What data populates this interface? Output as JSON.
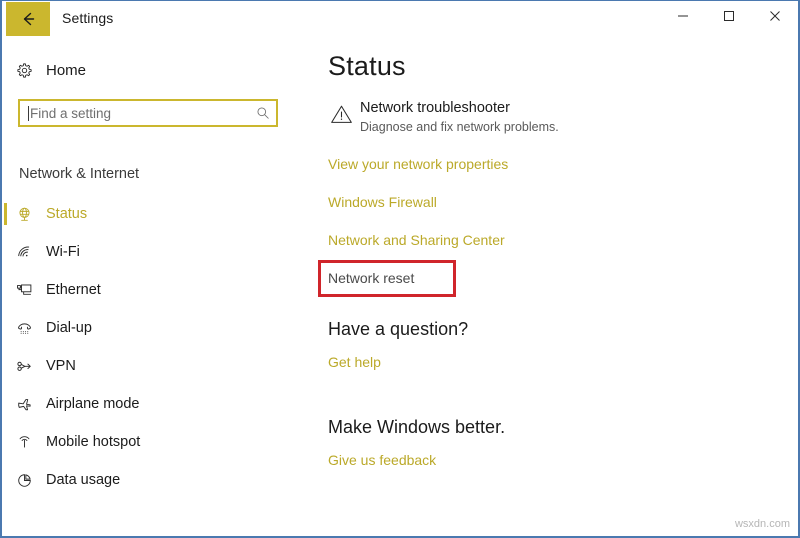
{
  "window": {
    "title": "Settings",
    "back_icon": "back-arrow-icon",
    "minimize_label": "─",
    "maximize_label": "□",
    "close_label": "✕",
    "border_color": "#4b79b0",
    "accent_color": "#cbb72e"
  },
  "sidebar": {
    "home": {
      "label": "Home",
      "icon": "gear-icon"
    },
    "search": {
      "value": "",
      "placeholder": "Find a setting",
      "icon": "search-icon"
    },
    "section_header": "Network & Internet",
    "items": [
      {
        "label": "Status",
        "icon": "globe-network-icon",
        "selected": true
      },
      {
        "label": "Wi-Fi",
        "icon": "wifi-icon",
        "selected": false
      },
      {
        "label": "Ethernet",
        "icon": "ethernet-icon",
        "selected": false
      },
      {
        "label": "Dial-up",
        "icon": "dialup-phone-icon",
        "selected": false
      },
      {
        "label": "VPN",
        "icon": "vpn-icon",
        "selected": false
      },
      {
        "label": "Airplane mode",
        "icon": "airplane-icon",
        "selected": false
      },
      {
        "label": "Mobile hotspot",
        "icon": "hotspot-icon",
        "selected": false
      },
      {
        "label": "Data usage",
        "icon": "pie-chart-icon",
        "selected": false
      }
    ]
  },
  "main": {
    "page_title": "Status",
    "troubleshooter": {
      "icon": "warning-triangle-icon",
      "title": "Network troubleshooter",
      "subtitle": "Diagnose and fix network problems."
    },
    "links": [
      {
        "label": "View your network properties",
        "highlighted": false
      },
      {
        "label": "Windows Firewall",
        "highlighted": false
      },
      {
        "label": "Network and Sharing Center",
        "highlighted": false
      },
      {
        "label": "Network reset",
        "highlighted": true
      }
    ],
    "sections": [
      {
        "heading": "Have a question?",
        "link": "Get help"
      },
      {
        "heading": "Make Windows better.",
        "link": "Give us feedback"
      }
    ],
    "annotation": {
      "target": "Network reset",
      "color": "#d0252b"
    }
  },
  "watermark": "wsxdn.com"
}
